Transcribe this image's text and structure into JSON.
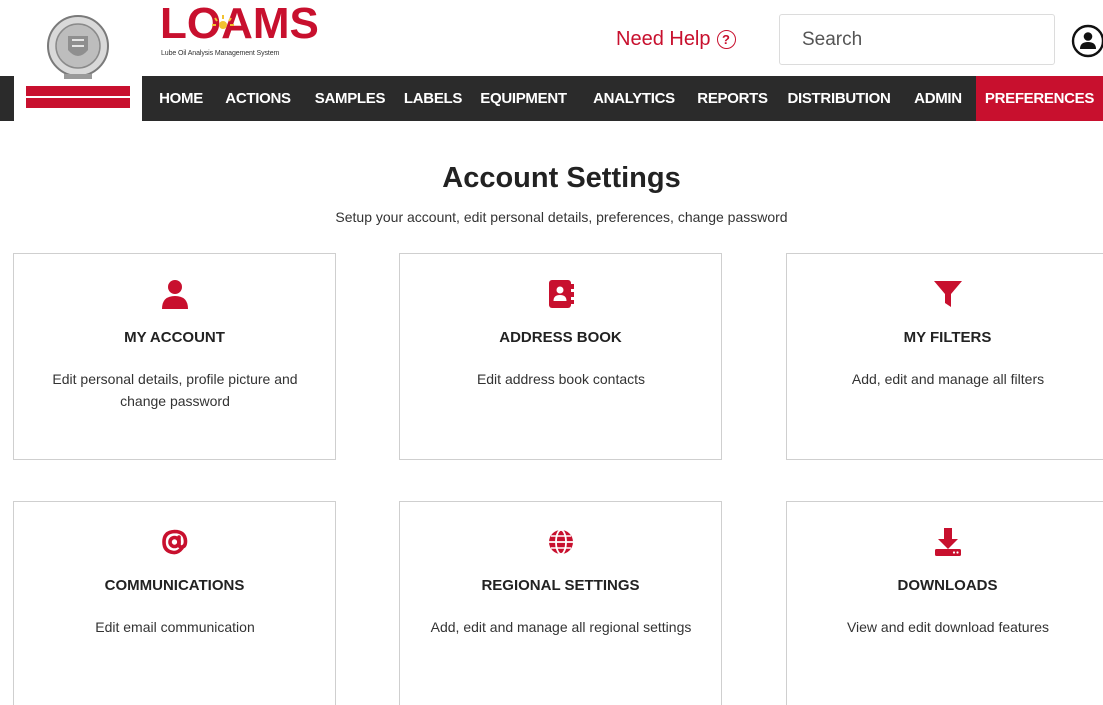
{
  "header": {
    "brand_word": "LOAMS",
    "brand_tagline": "Lube Oil Analysis Management System",
    "help_label": "Need Help",
    "help_symbol": "?",
    "search_placeholder": "Search",
    "accent_color": "#c8102e"
  },
  "nav": {
    "items": [
      {
        "label": "HOME"
      },
      {
        "label": "ACTIONS"
      },
      {
        "label": "SAMPLES"
      },
      {
        "label": "LABELS"
      },
      {
        "label": "EQUIPMENT"
      },
      {
        "label": "ANALYTICS"
      },
      {
        "label": "REPORTS"
      },
      {
        "label": "DISTRIBUTION"
      },
      {
        "label": "ADMIN"
      },
      {
        "label": "PREFERENCES",
        "active": true
      }
    ]
  },
  "page": {
    "title": "Account Settings",
    "subtitle": "Setup your account, edit personal details, preferences, change password"
  },
  "cards": [
    {
      "title": "MY ACCOUNT",
      "description": "Edit personal details, profile picture and change password",
      "icon": "user-icon"
    },
    {
      "title": "ADDRESS BOOK",
      "description": "Edit address book contacts",
      "icon": "address-book-icon"
    },
    {
      "title": "MY FILTERS",
      "description": "Add, edit and manage all filters",
      "icon": "filter-icon"
    },
    {
      "title": "COMMUNICATIONS",
      "description": "Edit email communication",
      "icon": "at-sign-icon"
    },
    {
      "title": "REGIONAL SETTINGS",
      "description": "Add, edit and manage all regional settings",
      "icon": "globe-icon"
    },
    {
      "title": "DOWNLOADS",
      "description": "View and edit download features",
      "icon": "download-icon"
    }
  ]
}
